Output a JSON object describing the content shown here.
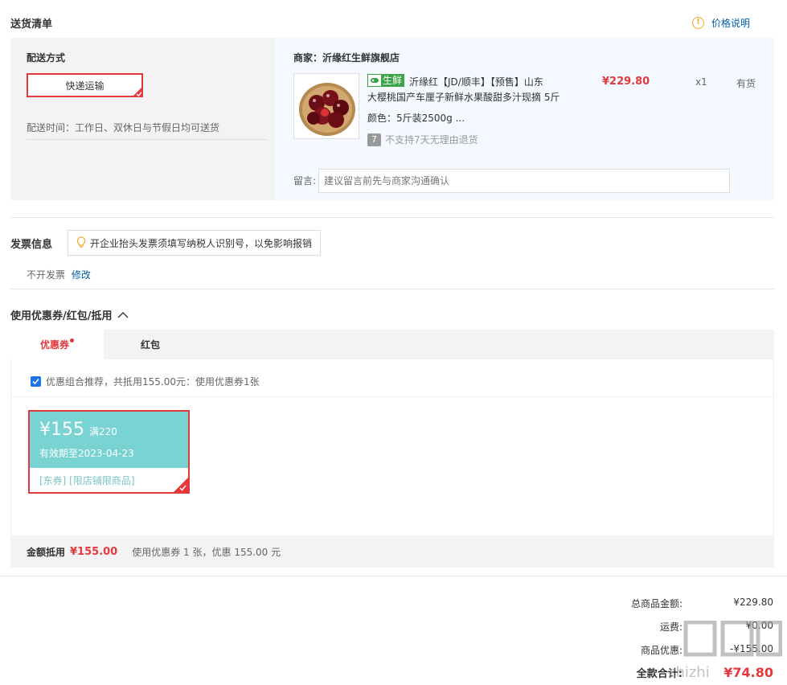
{
  "delivery": {
    "title": "送货清单",
    "price_note": "价格说明",
    "method_label": "配送方式",
    "method_option": "快递运输",
    "time_text": "配送时间：工作日、双休日与节假日均可送货",
    "merchant_label": "商家：",
    "merchant_name": "沂缘红生鲜旗舰店",
    "product": {
      "tag": "生鲜",
      "title_line1": "沂缘红【JD/顺丰】【预售】山东",
      "title_line2": "大樱桃国产车厘子新鲜水果酸甜多汁现摘 5斤",
      "price": "¥229.80",
      "qty": "x1",
      "stock": "有货",
      "spec": "颜色：5斤装2500g ...",
      "return_badge": "7",
      "return_text": "不支持7天无理由退货"
    },
    "message_label": "留言:",
    "message_placeholder": "建议留言前先与商家沟通确认"
  },
  "invoice": {
    "title": "发票信息",
    "tip": "开企业抬头发票须填写纳税人识别号，以免影响报销",
    "status": "不开发票",
    "edit": "修改"
  },
  "coupons": {
    "title": "使用优惠券/红包/抵用",
    "tabs": [
      {
        "label": "优惠券"
      },
      {
        "label": "红包"
      }
    ],
    "recommend_text": "优惠组合推荐，共抵用155.00元：使用优惠券1张",
    "card": {
      "amount": "¥155",
      "condition": "满220",
      "valid": "有效期至2023-04-23",
      "tags": "[东券]  [限店铺限商品]"
    },
    "summary_label": "金额抵用",
    "summary_amount": "¥155.00",
    "summary_text": "使用优惠券 1 张，优惠 155.00 元"
  },
  "totals": {
    "rows": [
      {
        "label": "总商品金额:",
        "value": "¥229.80"
      },
      {
        "label": "运费:",
        "value": "¥0.00"
      },
      {
        "label": "商品优惠:",
        "value": "-¥155.00"
      },
      {
        "label": "全款合计:",
        "value": "¥74.80"
      }
    ]
  },
  "colors": {
    "accent": "#e4393c",
    "coupon": "#79d3d3",
    "fresh": "#3aa546",
    "link": "#005ea7"
  },
  "watermark": "值 什么值得买"
}
